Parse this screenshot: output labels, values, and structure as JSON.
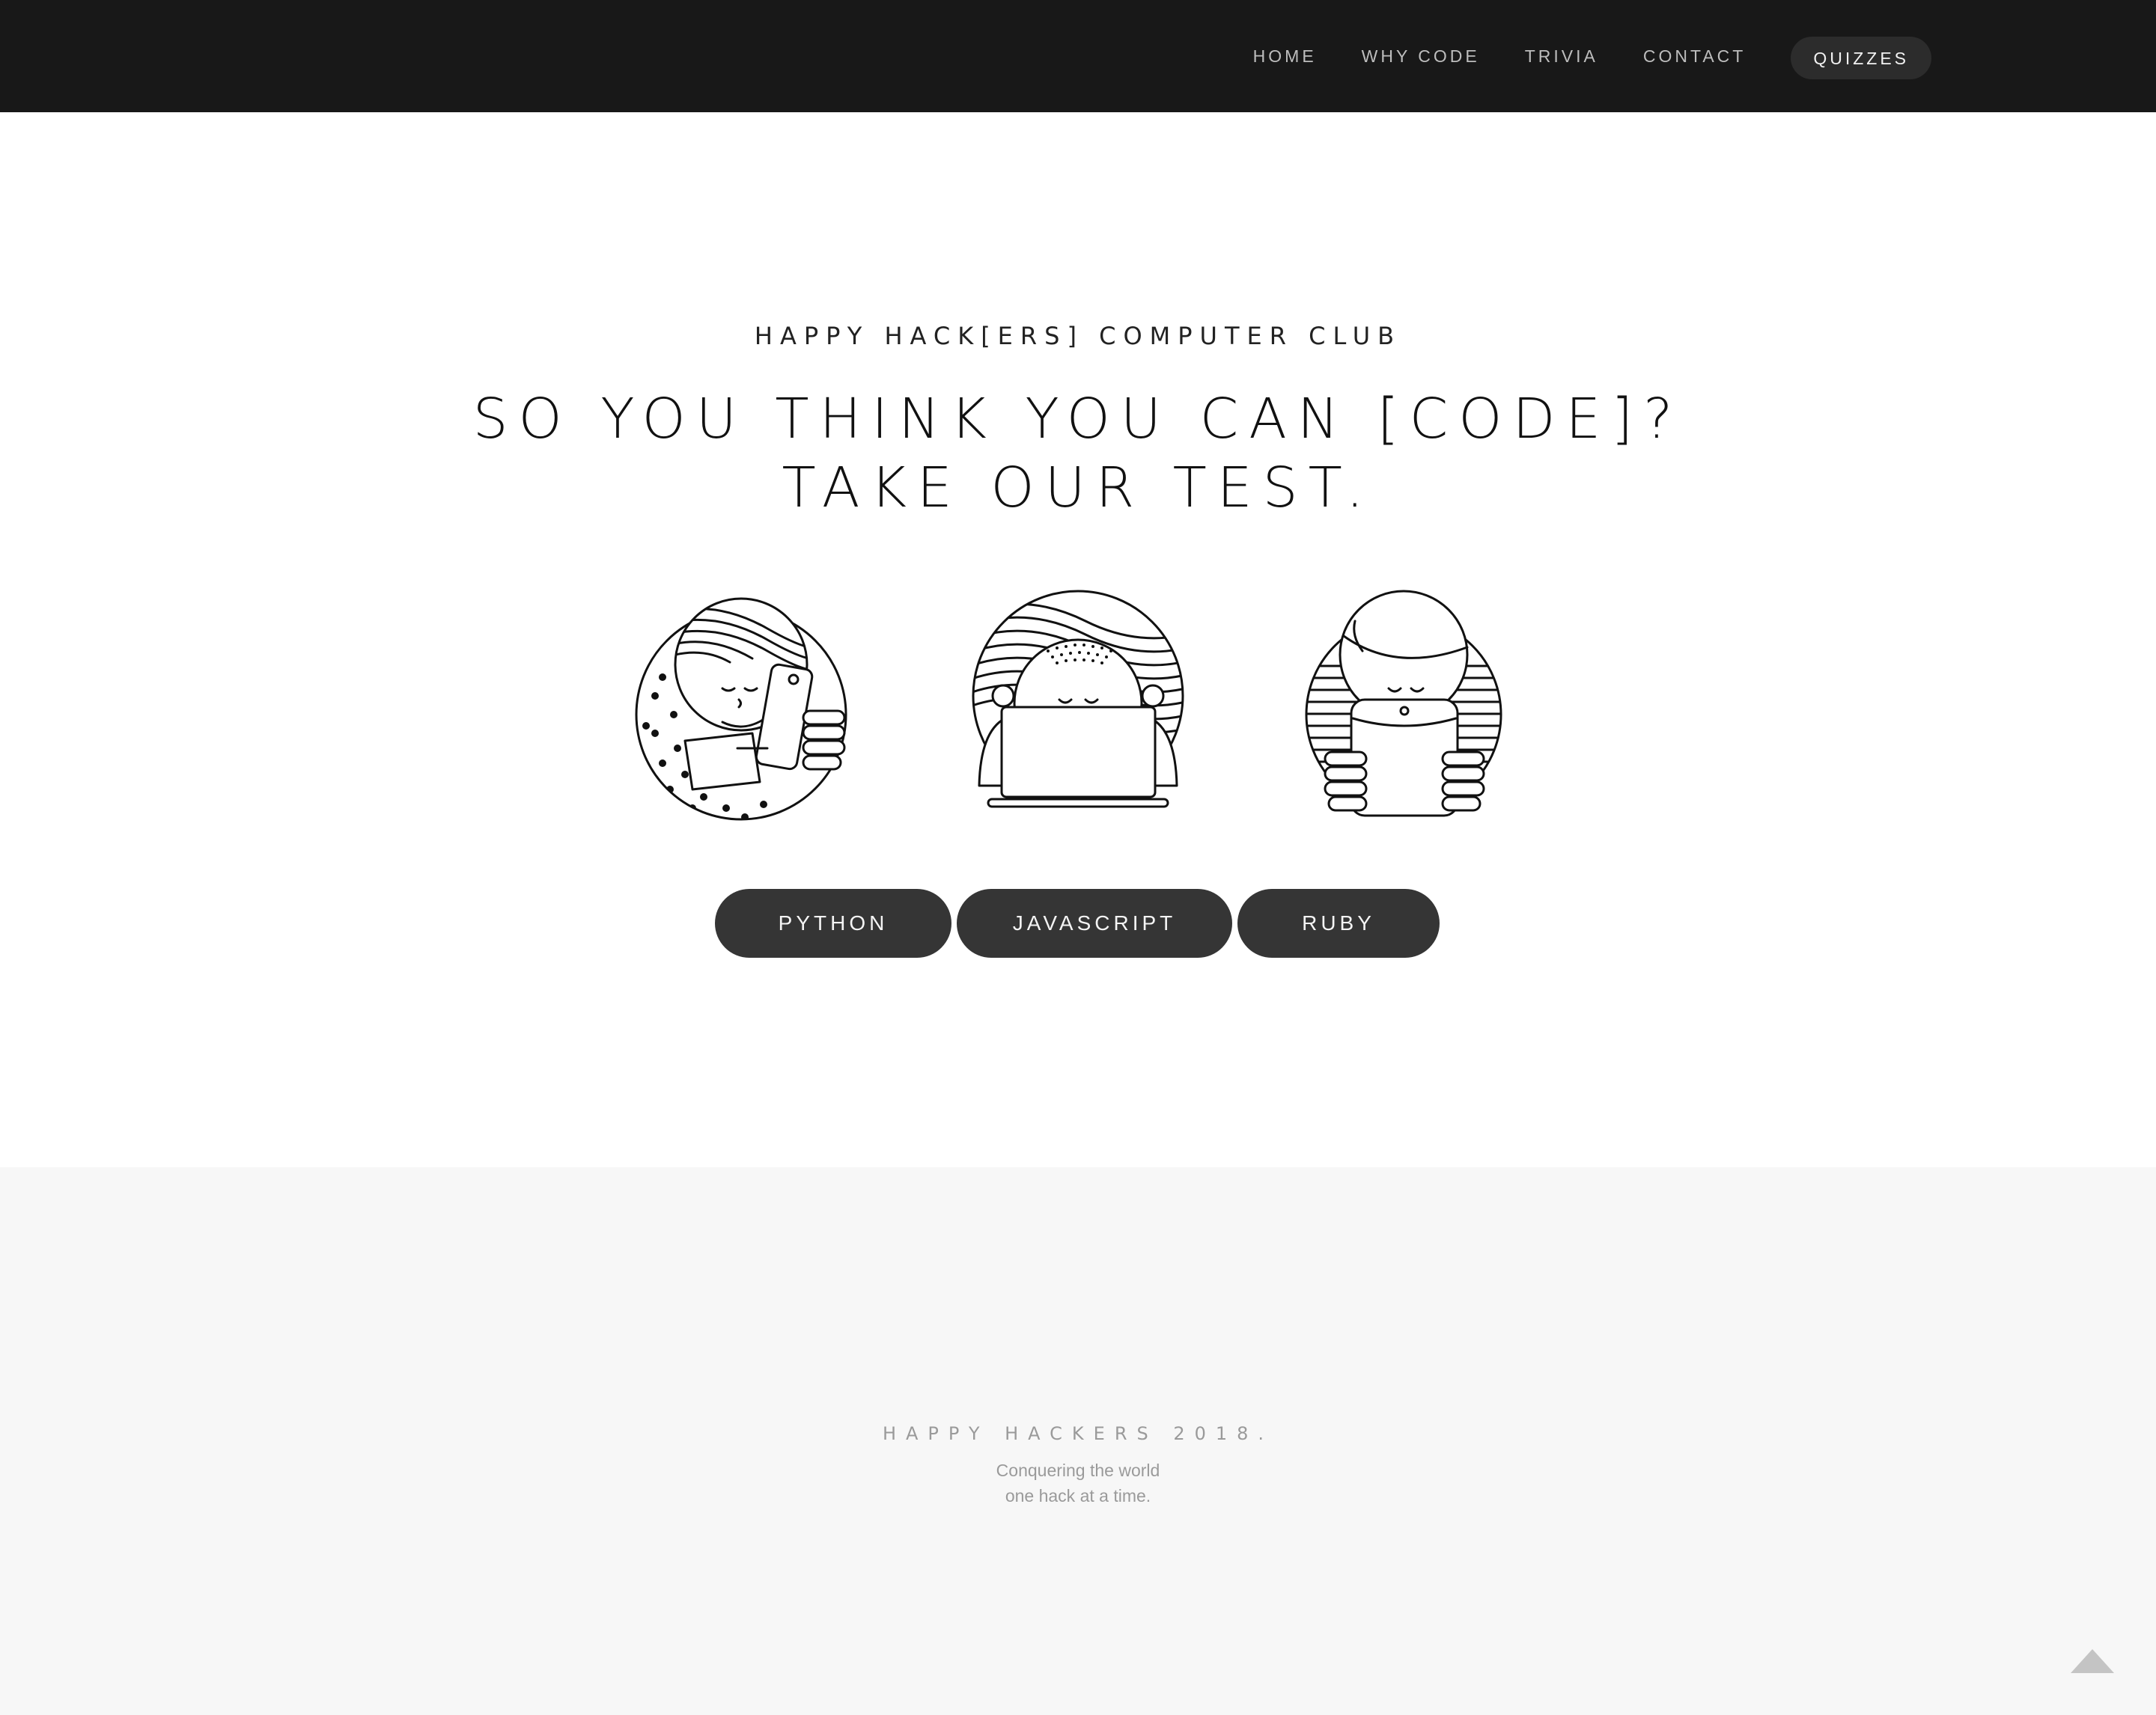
{
  "nav": {
    "links": [
      {
        "label": "HOME"
      },
      {
        "label": "WHY CODE"
      },
      {
        "label": "TRIVIA"
      },
      {
        "label": "CONTACT"
      }
    ],
    "active": {
      "label": "QUIZZES"
    }
  },
  "hero": {
    "eyebrow": "HAPPY HACK[ERS] COMPUTER CLUB",
    "headline_line1": "SO YOU THINK YOU CAN [CODE]?",
    "headline_line2": "TAKE OUR TEST."
  },
  "quizzes": [
    {
      "label": "PYTHON",
      "icon": "person-with-phone-icon"
    },
    {
      "label": "JAVASCRIPT",
      "icon": "person-with-laptop-icon"
    },
    {
      "label": "RUBY",
      "icon": "person-with-tablet-icon"
    }
  ],
  "footer": {
    "brand": "HAPPY HACKERS 2018.",
    "tagline_line1": "Conquering the world",
    "tagline_line2": "one hack at a time."
  },
  "colors": {
    "nav_bg": "#181818",
    "button_bg": "#353535",
    "footer_bg": "#f7f7f7"
  },
  "icons": {
    "scroll_top": "triangle-up-icon"
  }
}
